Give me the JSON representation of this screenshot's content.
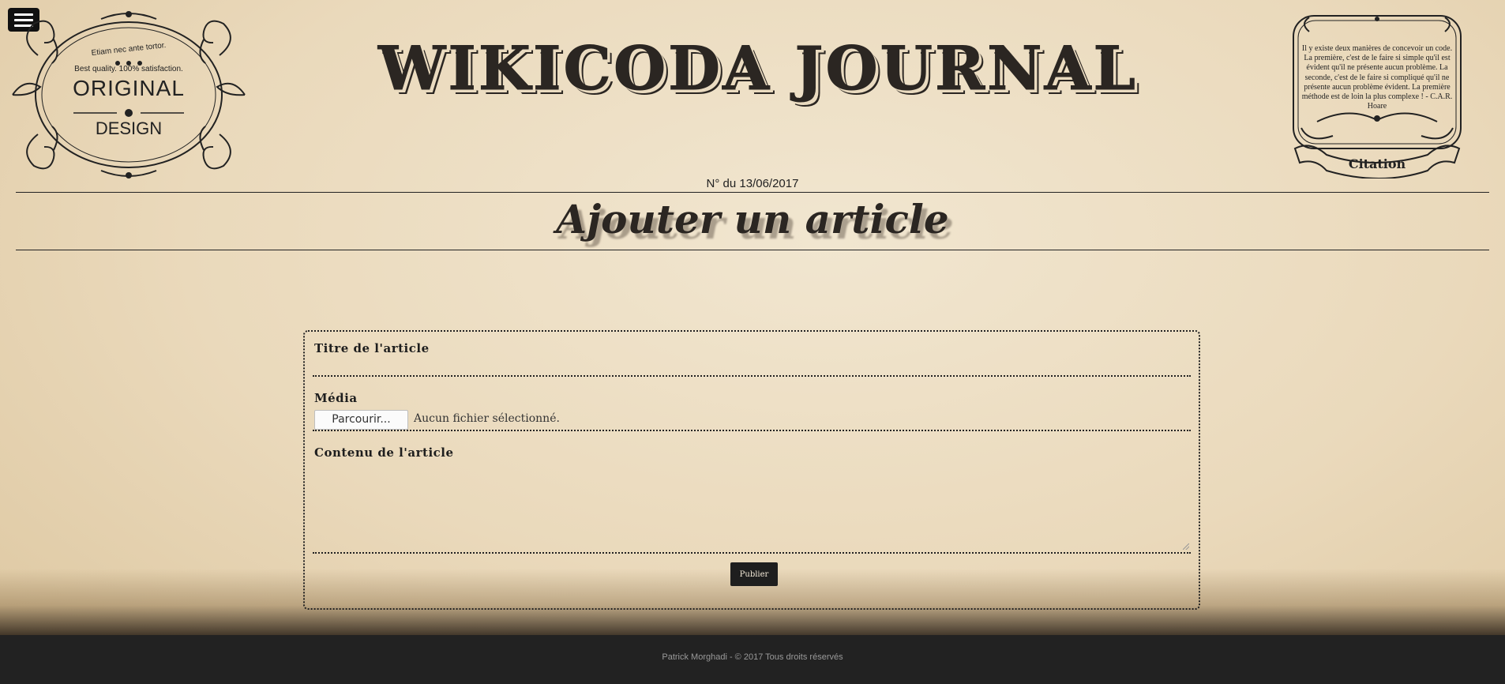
{
  "header": {
    "menu_icon": "hamburger-menu-icon",
    "logo": {
      "tagline": "Etiam nec ante tortor.",
      "quality": "Best quality. 100% satisfaction.",
      "line1": "ORIGINAL",
      "line2": "DESIGN"
    },
    "site_title": "WIKICODA JOURNAL",
    "quote": {
      "text": "Il y existe deux manières de concevoir un code. La première, c'est de le faire si simple qu'il est évident qu'il ne présente aucun problème. La seconde, c'est de le faire si compliqué qu'il ne présente aucun problème évident. La première méthode est de loin la plus complexe ! - C.A.R. Hoare",
      "label": "Citation"
    },
    "issue_date": "N° du 13/06/2017"
  },
  "main": {
    "page_title": "Ajouter un article"
  },
  "form": {
    "title_label": "Titre de l'article",
    "title_value": "",
    "media_label": "Média",
    "browse_label": "Parcourir...",
    "file_status": "Aucun fichier sélectionné.",
    "content_label": "Contenu de l'article",
    "content_value": "",
    "publish_label": "Publier"
  },
  "footer": {
    "text": "Patrick Morghadi - © 2017 Tous droits réservés"
  },
  "colors": {
    "paper": "#ead9bb",
    "ink": "#222222",
    "footer_bg": "#222222"
  }
}
